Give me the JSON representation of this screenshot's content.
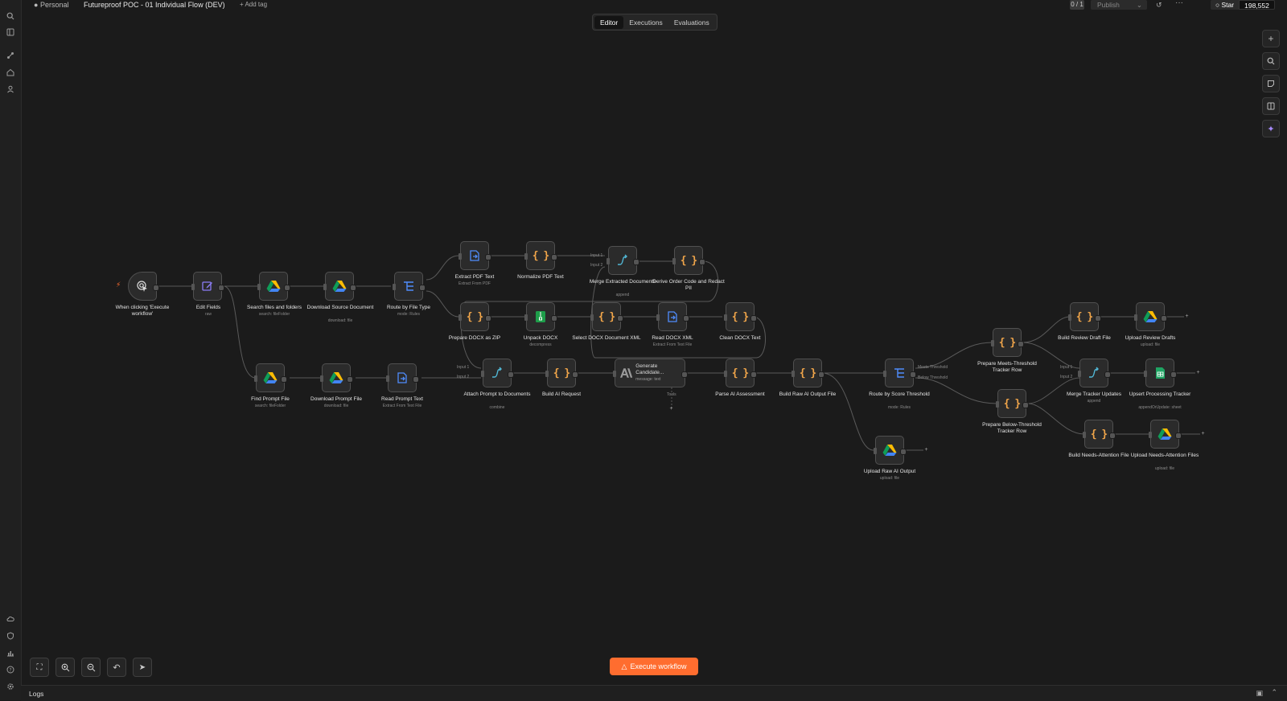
{
  "topbar": {
    "project": "Personal",
    "workflow_name": "Futureproof POC - 01 Individual Flow (DEV)",
    "add_tag": "+ Add tag",
    "counter": "0 / 1",
    "publish": "Publish",
    "star": "Star",
    "star_count": "198,552"
  },
  "tabs": [
    "Editor",
    "Executions",
    "Evaluations"
  ],
  "nodes": {
    "trigger": {
      "label": "When clicking 'Execute workflow'"
    },
    "edit_fields": {
      "label": "Edit Fields",
      "sub": "raw"
    },
    "search_files": {
      "label": "Search files and folders",
      "sub": "search: fileFolder"
    },
    "download_source": {
      "label": "Download Source Document",
      "sub": "download: file"
    },
    "route_file_type": {
      "label": "Route by File Type",
      "sub": "mode: Rules"
    },
    "extract_pdf": {
      "label": "Extract PDF Text",
      "sub": "Extract From PDF"
    },
    "normalize_pdf": {
      "label": "Normalize PDF Text"
    },
    "merge_extracted": {
      "label": "Merge Extracted Documents",
      "sub": "append"
    },
    "derive_order": {
      "label": "Derive Order Code and Redact PII"
    },
    "prepare_docx": {
      "label": "Prepare DOCX as ZIP"
    },
    "unpack_docx": {
      "label": "Unpack DOCX",
      "sub": "decompress"
    },
    "select_docx": {
      "label": "Select DOCX Document XML"
    },
    "read_docx": {
      "label": "Read DOCX XML",
      "sub": "Extract From Text File"
    },
    "clean_docx": {
      "label": "Clean DOCX Text"
    },
    "find_prompt": {
      "label": "Find Prompt File",
      "sub": "search: fileFolder"
    },
    "download_prompt": {
      "label": "Download Prompt File",
      "sub": "download: file"
    },
    "read_prompt": {
      "label": "Read Prompt Text",
      "sub": "Extract From Text File"
    },
    "attach_prompt": {
      "label": "Attach Prompt to Documents",
      "sub": "combine"
    },
    "build_ai": {
      "label": "Build AI Request"
    },
    "generate": {
      "label": "Generate Candidate...",
      "sub": "message: text"
    },
    "parse_ai": {
      "label": "Parse AI Assessment"
    },
    "build_raw": {
      "label": "Build Raw AI Output File"
    },
    "route_score": {
      "label": "Route by Score Threshold",
      "sub": "mode: Rules"
    },
    "upload_raw": {
      "label": "Upload Raw AI Output",
      "sub": "upload: file"
    },
    "prep_meets": {
      "label": "Prepare Meets-Threshold Tracker Row"
    },
    "prep_below": {
      "label": "Prepare Below-Threshold Tracker Row"
    },
    "build_review": {
      "label": "Build Review Draft File"
    },
    "upload_review": {
      "label": "Upload Review Drafts",
      "sub": "upload: file"
    },
    "merge_tracker": {
      "label": "Merge Tracker Updates",
      "sub": "append"
    },
    "upsert": {
      "label": "Upsert Processing Tracker",
      "sub": "appendOrUpdate: sheet"
    },
    "build_needs": {
      "label": "Build Needs-Attention File"
    },
    "upload_needs": {
      "label": "Upload Needs-Attention Files",
      "sub": "upload: file"
    }
  },
  "edge_labels": {
    "input1a": "Input 1",
    "input2a": "Input 2",
    "input1b": "Input 1",
    "input2b": "Input 2",
    "input1c": "Input 1",
    "input2c": "Input 2",
    "meets": "Meets Threshold",
    "below": "Below Threshold",
    "tools": "Tools"
  },
  "execute_button": "Execute workflow",
  "logs": "Logs",
  "colors": {
    "accent": "#ff6d2f",
    "code": "#f0a54a",
    "router": "#4f8dfd",
    "merge": "#51b8d6"
  }
}
